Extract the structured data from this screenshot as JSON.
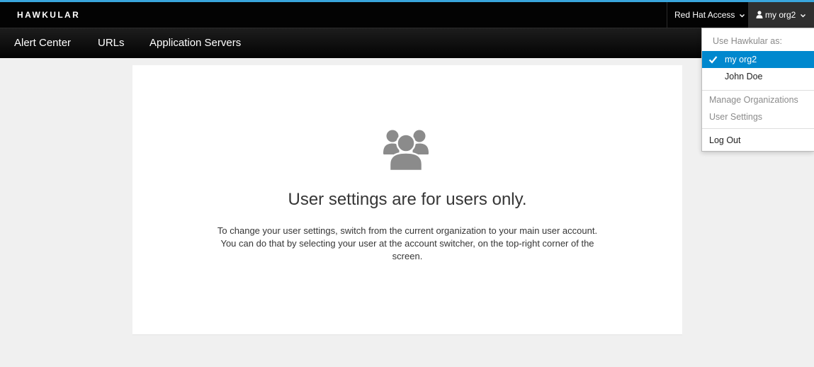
{
  "brand": "HAWKULAR",
  "utility": {
    "red_hat_access": "Red Hat Access",
    "user_label": "my org2"
  },
  "nav": {
    "items": [
      {
        "label": "Alert Center"
      },
      {
        "label": "URLs"
      },
      {
        "label": "Application Servers"
      }
    ]
  },
  "dropdown": {
    "header": "Use Hawkular as:",
    "personas": [
      {
        "label": "my org2",
        "selected": true
      },
      {
        "label": "John Doe",
        "selected": false
      }
    ],
    "links": [
      {
        "label": "Manage Organizations"
      },
      {
        "label": "User Settings"
      }
    ],
    "logout": "Log Out"
  },
  "main": {
    "icon": "users-group-icon",
    "title": "User settings are for users only.",
    "body": "To change your user settings, switch from the current organization to your main user account. You can do that by selecting your user at the account switcher, on the top-right corner of the screen."
  },
  "colors": {
    "accent": "#39a5dc",
    "selected": "#0088ce",
    "navbar": "#030303",
    "page_background": "#f0f0f0"
  }
}
